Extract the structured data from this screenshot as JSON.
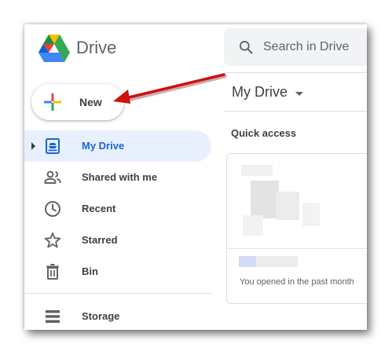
{
  "header": {
    "app_title": "Drive",
    "search": {
      "placeholder": "Search in Drive",
      "value": ""
    }
  },
  "new_button": {
    "label": "New"
  },
  "sidebar": {
    "items": [
      {
        "label": "My Drive",
        "icon": "my-drive-icon",
        "active": true
      },
      {
        "label": "Shared with me",
        "icon": "shared-people-icon",
        "active": false
      },
      {
        "label": "Recent",
        "icon": "clock-icon",
        "active": false
      },
      {
        "label": "Starred",
        "icon": "star-icon",
        "active": false
      },
      {
        "label": "Bin",
        "icon": "trash-icon",
        "active": false
      },
      {
        "label": "Storage",
        "icon": "storage-icon",
        "active": false
      }
    ]
  },
  "main": {
    "title": "My Drive",
    "quick_access": {
      "heading": "Quick access",
      "card": {
        "subtitle": "You opened in the past month"
      }
    }
  },
  "colors": {
    "active_bg": "#e8f0fe",
    "active_text": "#1967d2",
    "annotation_arrow": "#cc1111"
  }
}
